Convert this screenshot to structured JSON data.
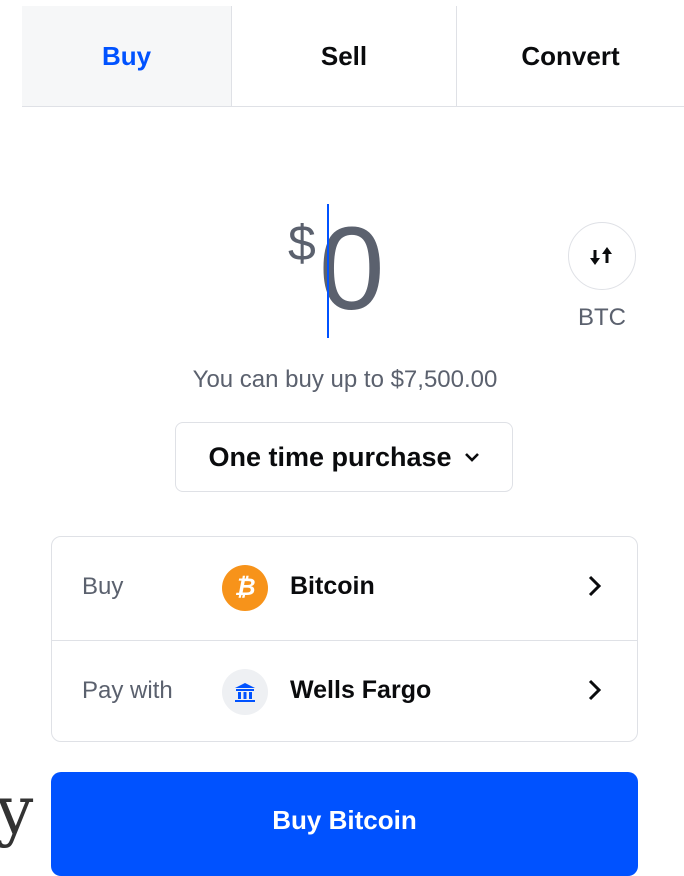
{
  "tabs": [
    {
      "label": "Buy",
      "active": true
    },
    {
      "label": "Sell",
      "active": false
    },
    {
      "label": "Convert",
      "active": false
    }
  ],
  "amount": {
    "currency_symbol": "$",
    "value": "0"
  },
  "unit_switch": {
    "icon": "swap-vertical-arrows-icon",
    "label": "BTC"
  },
  "limit_text": "You can buy up to $7,500.00",
  "frequency": {
    "selected": "One time purchase",
    "icon": "chevron-down-icon"
  },
  "order": {
    "rows": [
      {
        "label": "Buy",
        "value": "Bitcoin",
        "icon": "bitcoin-icon",
        "icon_glyph": "₿"
      },
      {
        "label": "Pay with",
        "value": "Wells Fargo",
        "icon": "bank-icon"
      }
    ]
  },
  "primary_button": {
    "label": "Buy Bitcoin"
  },
  "background_text": "y",
  "colors": {
    "accent": "#0052ff",
    "bitcoin": "#f7931a",
    "muted_text": "#5b616e",
    "border": "#dfe1e6"
  }
}
